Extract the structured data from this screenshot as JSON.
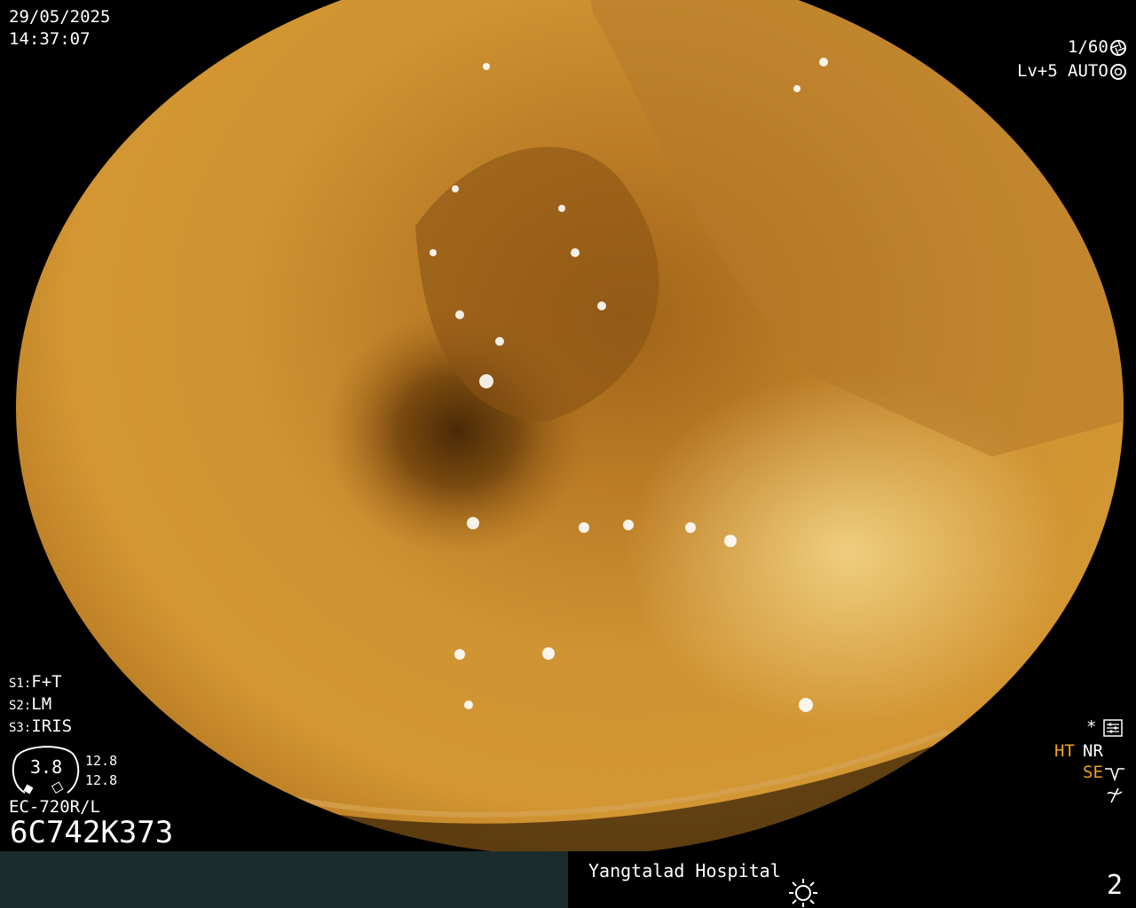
{
  "datetime": {
    "date": "29/05/2025",
    "time": "14:37:07"
  },
  "exposure": {
    "shutter": "1/60",
    "level": "Lv+5",
    "mode": "AUTO"
  },
  "settings": [
    {
      "key": "S1:",
      "value": "F+T"
    },
    {
      "key": "S2:",
      "value": "LM"
    },
    {
      "key": "S3:",
      "value": "IRIS"
    }
  ],
  "gauge": {
    "value": "3.8",
    "top": "12.8",
    "bottom": "12.8"
  },
  "scope": {
    "model": "EC-720R/L",
    "serial": "6C742K373"
  },
  "enhancement": {
    "star": "*",
    "ht": "HT",
    "nr": "NR",
    "se": "SE"
  },
  "footer": {
    "hospital": "Yangtalad Hospital",
    "frame": "2"
  },
  "colors": {
    "accent": "#f0a020",
    "footer_bg": "#1b2c2c"
  },
  "icons": [
    "aperture-icon",
    "shutter-icon",
    "menu-settings-icon",
    "sun-icon",
    "wave-icon",
    "crossed-wave-icon"
  ]
}
